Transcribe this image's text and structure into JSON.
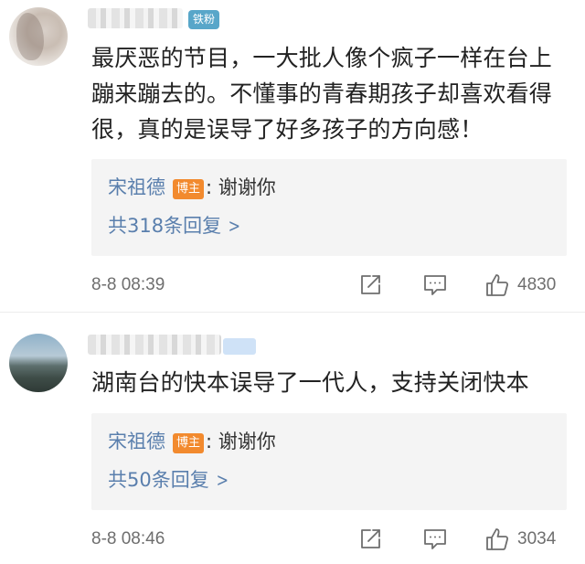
{
  "comments": [
    {
      "badge": "铁粉",
      "text": "最厌恶的节目，一大批人像个疯子一样在台上蹦来蹦去的。不懂事的青春期孩子却喜欢看得很，真的是误导了好多孩子的方向感！",
      "reply": {
        "user": "宋祖德",
        "host_label": "博主",
        "separator": ":",
        "text": "谢谢你",
        "count_text": "共318条回复"
      },
      "time": "8-8 08:39",
      "likes": "4830"
    },
    {
      "badge": "",
      "text": "湖南台的快本误导了一代人，支持关闭快本",
      "reply": {
        "user": "宋祖德",
        "host_label": "博主",
        "separator": ":",
        "text": "谢谢你",
        "count_text": "共50条回复"
      },
      "time": "8-8 08:46",
      "likes": "3034"
    }
  ],
  "icons": {
    "share": "share-icon",
    "comment": "comment-icon",
    "like": "thumbs-up-icon",
    "chevron": "chevron-right-icon"
  },
  "colors": {
    "link_blue": "#5a7fad",
    "host_orange": "#f28a2e",
    "fan_badge": "#58a6c9",
    "reply_bg": "#f4f4f4"
  }
}
